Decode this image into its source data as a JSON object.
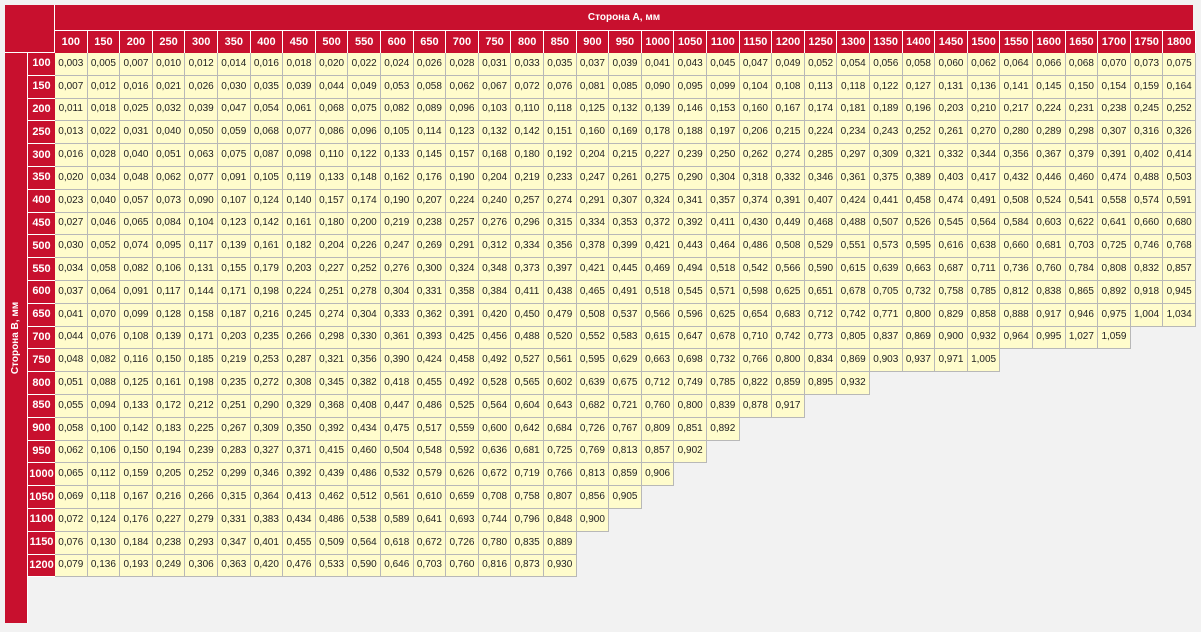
{
  "table": {
    "col_header_title": "Сторона А, мм",
    "row_header_title": "Сторона В, мм",
    "columns": [
      "100",
      "150",
      "200",
      "250",
      "300",
      "350",
      "400",
      "450",
      "500",
      "550",
      "600",
      "650",
      "700",
      "750",
      "800",
      "850",
      "900",
      "950",
      "1000",
      "1050",
      "1100",
      "1150",
      "1200",
      "1250",
      "1300",
      "1350",
      "1400",
      "1450",
      "1500",
      "1550",
      "1600",
      "1650",
      "1700",
      "1750",
      "1800"
    ],
    "rows": [
      {
        "label": "100",
        "values": [
          "0,003",
          "0,005",
          "0,007",
          "0,010",
          "0,012",
          "0,014",
          "0,016",
          "0,018",
          "0,020",
          "0,022",
          "0,024",
          "0,026",
          "0,028",
          "0,031",
          "0,033",
          "0,035",
          "0,037",
          "0,039",
          "0,041",
          "0,043",
          "0,045",
          "0,047",
          "0,049",
          "0,052",
          "0,054",
          "0,056",
          "0,058",
          "0,060",
          "0,062",
          "0,064",
          "0,066",
          "0,068",
          "0,070",
          "0,073",
          "0,075"
        ]
      },
      {
        "label": "150",
        "values": [
          "0,007",
          "0,012",
          "0,016",
          "0,021",
          "0,026",
          "0,030",
          "0,035",
          "0,039",
          "0,044",
          "0,049",
          "0,053",
          "0,058",
          "0,062",
          "0,067",
          "0,072",
          "0,076",
          "0,081",
          "0,085",
          "0,090",
          "0,095",
          "0,099",
          "0,104",
          "0,108",
          "0,113",
          "0,118",
          "0,122",
          "0,127",
          "0,131",
          "0,136",
          "0,141",
          "0,145",
          "0,150",
          "0,154",
          "0,159",
          "0,164"
        ]
      },
      {
        "label": "200",
        "values": [
          "0,011",
          "0,018",
          "0,025",
          "0,032",
          "0,039",
          "0,047",
          "0,054",
          "0,061",
          "0,068",
          "0,075",
          "0,082",
          "0,089",
          "0,096",
          "0,103",
          "0,110",
          "0,118",
          "0,125",
          "0,132",
          "0,139",
          "0,146",
          "0,153",
          "0,160",
          "0,167",
          "0,174",
          "0,181",
          "0,189",
          "0,196",
          "0,203",
          "0,210",
          "0,217",
          "0,224",
          "0,231",
          "0,238",
          "0,245",
          "0,252"
        ]
      },
      {
        "label": "250",
        "values": [
          "0,013",
          "0,022",
          "0,031",
          "0,040",
          "0,050",
          "0,059",
          "0,068",
          "0,077",
          "0,086",
          "0,096",
          "0,105",
          "0,114",
          "0,123",
          "0,132",
          "0,142",
          "0,151",
          "0,160",
          "0,169",
          "0,178",
          "0,188",
          "0,197",
          "0,206",
          "0,215",
          "0,224",
          "0,234",
          "0,243",
          "0,252",
          "0,261",
          "0,270",
          "0,280",
          "0,289",
          "0,298",
          "0,307",
          "0,316",
          "0,326"
        ]
      },
      {
        "label": "300",
        "values": [
          "0,016",
          "0,028",
          "0,040",
          "0,051",
          "0,063",
          "0,075",
          "0,087",
          "0,098",
          "0,110",
          "0,122",
          "0,133",
          "0,145",
          "0,157",
          "0,168",
          "0,180",
          "0,192",
          "0,204",
          "0,215",
          "0,227",
          "0,239",
          "0,250",
          "0,262",
          "0,274",
          "0,285",
          "0,297",
          "0,309",
          "0,321",
          "0,332",
          "0,344",
          "0,356",
          "0,367",
          "0,379",
          "0,391",
          "0,402",
          "0,414"
        ]
      },
      {
        "label": "350",
        "values": [
          "0,020",
          "0,034",
          "0,048",
          "0,062",
          "0,077",
          "0,091",
          "0,105",
          "0,119",
          "0,133",
          "0,148",
          "0,162",
          "0,176",
          "0,190",
          "0,204",
          "0,219",
          "0,233",
          "0,247",
          "0,261",
          "0,275",
          "0,290",
          "0,304",
          "0,318",
          "0,332",
          "0,346",
          "0,361",
          "0,375",
          "0,389",
          "0,403",
          "0,417",
          "0,432",
          "0,446",
          "0,460",
          "0,474",
          "0,488",
          "0,503"
        ]
      },
      {
        "label": "400",
        "values": [
          "0,023",
          "0,040",
          "0,057",
          "0,073",
          "0,090",
          "0,107",
          "0,124",
          "0,140",
          "0,157",
          "0,174",
          "0,190",
          "0,207",
          "0,224",
          "0,240",
          "0,257",
          "0,274",
          "0,291",
          "0,307",
          "0,324",
          "0,341",
          "0,357",
          "0,374",
          "0,391",
          "0,407",
          "0,424",
          "0,441",
          "0,458",
          "0,474",
          "0,491",
          "0,508",
          "0,524",
          "0,541",
          "0,558",
          "0,574",
          "0,591"
        ]
      },
      {
        "label": "450",
        "values": [
          "0,027",
          "0,046",
          "0,065",
          "0,084",
          "0,104",
          "0,123",
          "0,142",
          "0,161",
          "0,180",
          "0,200",
          "0,219",
          "0,238",
          "0,257",
          "0,276",
          "0,296",
          "0,315",
          "0,334",
          "0,353",
          "0,372",
          "0,392",
          "0,411",
          "0,430",
          "0,449",
          "0,468",
          "0,488",
          "0,507",
          "0,526",
          "0,545",
          "0,564",
          "0,584",
          "0,603",
          "0,622",
          "0,641",
          "0,660",
          "0,680"
        ]
      },
      {
        "label": "500",
        "values": [
          "0,030",
          "0,052",
          "0,074",
          "0,095",
          "0,117",
          "0,139",
          "0,161",
          "0,182",
          "0,204",
          "0,226",
          "0,247",
          "0,269",
          "0,291",
          "0,312",
          "0,334",
          "0,356",
          "0,378",
          "0,399",
          "0,421",
          "0,443",
          "0,464",
          "0,486",
          "0,508",
          "0,529",
          "0,551",
          "0,573",
          "0,595",
          "0,616",
          "0,638",
          "0,660",
          "0,681",
          "0,703",
          "0,725",
          "0,746",
          "0,768"
        ]
      },
      {
        "label": "550",
        "values": [
          "0,034",
          "0,058",
          "0,082",
          "0,106",
          "0,131",
          "0,155",
          "0,179",
          "0,203",
          "0,227",
          "0,252",
          "0,276",
          "0,300",
          "0,324",
          "0,348",
          "0,373",
          "0,397",
          "0,421",
          "0,445",
          "0,469",
          "0,494",
          "0,518",
          "0,542",
          "0,566",
          "0,590",
          "0,615",
          "0,639",
          "0,663",
          "0,687",
          "0,711",
          "0,736",
          "0,760",
          "0,784",
          "0,808",
          "0,832",
          "0,857"
        ]
      },
      {
        "label": "600",
        "values": [
          "0,037",
          "0,064",
          "0,091",
          "0,117",
          "0,144",
          "0,171",
          "0,198",
          "0,224",
          "0,251",
          "0,278",
          "0,304",
          "0,331",
          "0,358",
          "0,384",
          "0,411",
          "0,438",
          "0,465",
          "0,491",
          "0,518",
          "0,545",
          "0,571",
          "0,598",
          "0,625",
          "0,651",
          "0,678",
          "0,705",
          "0,732",
          "0,758",
          "0,785",
          "0,812",
          "0,838",
          "0,865",
          "0,892",
          "0,918",
          "0,945"
        ]
      },
      {
        "label": "650",
        "values": [
          "0,041",
          "0,070",
          "0,099",
          "0,128",
          "0,158",
          "0,187",
          "0,216",
          "0,245",
          "0,274",
          "0,304",
          "0,333",
          "0,362",
          "0,391",
          "0,420",
          "0,450",
          "0,479",
          "0,508",
          "0,537",
          "0,566",
          "0,596",
          "0,625",
          "0,654",
          "0,683",
          "0,712",
          "0,742",
          "0,771",
          "0,800",
          "0,829",
          "0,858",
          "0,888",
          "0,917",
          "0,946",
          "0,975",
          "1,004",
          "1,034"
        ]
      },
      {
        "label": "700",
        "values": [
          "0,044",
          "0,076",
          "0,108",
          "0,139",
          "0,171",
          "0,203",
          "0,235",
          "0,266",
          "0,298",
          "0,330",
          "0,361",
          "0,393",
          "0,425",
          "0,456",
          "0,488",
          "0,520",
          "0,552",
          "0,583",
          "0,615",
          "0,647",
          "0,678",
          "0,710",
          "0,742",
          "0,773",
          "0,805",
          "0,837",
          "0,869",
          "0,900",
          "0,932",
          "0,964",
          "0,995",
          "1,027",
          "1,059"
        ]
      },
      {
        "label": "750",
        "values": [
          "0,048",
          "0,082",
          "0,116",
          "0,150",
          "0,185",
          "0,219",
          "0,253",
          "0,287",
          "0,321",
          "0,356",
          "0,390",
          "0,424",
          "0,458",
          "0,492",
          "0,527",
          "0,561",
          "0,595",
          "0,629",
          "0,663",
          "0,698",
          "0,732",
          "0,766",
          "0,800",
          "0,834",
          "0,869",
          "0,903",
          "0,937",
          "0,971",
          "1,005"
        ]
      },
      {
        "label": "800",
        "values": [
          "0,051",
          "0,088",
          "0,125",
          "0,161",
          "0,198",
          "0,235",
          "0,272",
          "0,308",
          "0,345",
          "0,382",
          "0,418",
          "0,455",
          "0,492",
          "0,528",
          "0,565",
          "0,602",
          "0,639",
          "0,675",
          "0,712",
          "0,749",
          "0,785",
          "0,822",
          "0,859",
          "0,895",
          "0,932"
        ]
      },
      {
        "label": "850",
        "values": [
          "0,055",
          "0,094",
          "0,133",
          "0,172",
          "0,212",
          "0,251",
          "0,290",
          "0,329",
          "0,368",
          "0,408",
          "0,447",
          "0,486",
          "0,525",
          "0,564",
          "0,604",
          "0,643",
          "0,682",
          "0,721",
          "0,760",
          "0,800",
          "0,839",
          "0,878",
          "0,917"
        ]
      },
      {
        "label": "900",
        "values": [
          "0,058",
          "0,100",
          "0,142",
          "0,183",
          "0,225",
          "0,267",
          "0,309",
          "0,350",
          "0,392",
          "0,434",
          "0,475",
          "0,517",
          "0,559",
          "0,600",
          "0,642",
          "0,684",
          "0,726",
          "0,767",
          "0,809",
          "0,851",
          "0,892"
        ]
      },
      {
        "label": "950",
        "values": [
          "0,062",
          "0,106",
          "0,150",
          "0,194",
          "0,239",
          "0,283",
          "0,327",
          "0,371",
          "0,415",
          "0,460",
          "0,504",
          "0,548",
          "0,592",
          "0,636",
          "0,681",
          "0,725",
          "0,769",
          "0,813",
          "0,857",
          "0,902"
        ]
      },
      {
        "label": "1000",
        "values": [
          "0,065",
          "0,112",
          "0,159",
          "0,205",
          "0,252",
          "0,299",
          "0,346",
          "0,392",
          "0,439",
          "0,486",
          "0,532",
          "0,579",
          "0,626",
          "0,672",
          "0,719",
          "0,766",
          "0,813",
          "0,859",
          "0,906"
        ]
      },
      {
        "label": "1050",
        "values": [
          "0,069",
          "0,118",
          "0,167",
          "0,216",
          "0,266",
          "0,315",
          "0,364",
          "0,413",
          "0,462",
          "0,512",
          "0,561",
          "0,610",
          "0,659",
          "0,708",
          "0,758",
          "0,807",
          "0,856",
          "0,905"
        ]
      },
      {
        "label": "1100",
        "values": [
          "0,072",
          "0,124",
          "0,176",
          "0,227",
          "0,279",
          "0,331",
          "0,383",
          "0,434",
          "0,486",
          "0,538",
          "0,589",
          "0,641",
          "0,693",
          "0,744",
          "0,796",
          "0,848",
          "0,900"
        ]
      },
      {
        "label": "1150",
        "values": [
          "0,076",
          "0,130",
          "0,184",
          "0,238",
          "0,293",
          "0,347",
          "0,401",
          "0,455",
          "0,509",
          "0,564",
          "0,618",
          "0,672",
          "0,726",
          "0,780",
          "0,835",
          "0,889"
        ]
      },
      {
        "label": "1200",
        "values": [
          "0,079",
          "0,136",
          "0,193",
          "0,249",
          "0,306",
          "0,363",
          "0,420",
          "0,476",
          "0,533",
          "0,590",
          "0,646",
          "0,703",
          "0,760",
          "0,816",
          "0,873",
          "0,930"
        ]
      }
    ]
  },
  "colors": {
    "header_red": "#c8102e",
    "cell_yellow": "#fffccc",
    "background": "#f2f2f2"
  }
}
